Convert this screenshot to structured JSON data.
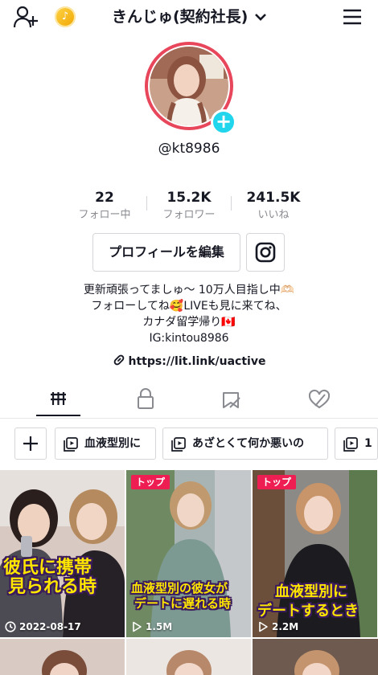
{
  "header": {
    "username": "きんじゅ(契約社長)"
  },
  "profile": {
    "handle": "@kt8986",
    "stats": [
      {
        "value": "22",
        "label": "フォロー中"
      },
      {
        "value": "15.2K",
        "label": "フォロワー"
      },
      {
        "value": "241.5K",
        "label": "いいね"
      }
    ],
    "edit_button": "プロフィールを編集",
    "bio": [
      "更新頑張ってましゅ〜 10万人目指し中🫶🏻",
      "フォローしてね🥰LIVEも見に来てね、",
      "カナダ留学帰り🇨🇦",
      "IG:kintou8986"
    ],
    "link": "https://lit.link/uactive"
  },
  "playlists": [
    "血液型別に",
    "あざとくて何か悪いの",
    "1"
  ],
  "videos": [
    {
      "caption_lines": [
        "彼氏に携帯",
        "見られる時"
      ],
      "meta": "2022-08-17",
      "meta_icon": "clock-icon",
      "badge": ""
    },
    {
      "caption_lines": [
        "血液型別の彼女が",
        "デートに遅れる時"
      ],
      "meta": "1.5M",
      "meta_icon": "play-icon",
      "badge": "トップ"
    },
    {
      "caption_lines": [
        "血液型別に",
        "デートするとき"
      ],
      "meta": "2.2M",
      "meta_icon": "play-icon",
      "badge": "トップ"
    }
  ],
  "colors": {
    "accent_pink": "#ee1d52",
    "add_blue": "#20d5ec",
    "avatar_ring": "#e8475b",
    "caption_yellow": "#ffe600"
  },
  "icons": [
    "add-user-icon",
    "coin-icon",
    "chevron-down-icon",
    "menu-icon",
    "instagram-icon",
    "link-icon",
    "videos-tab-icon",
    "lock-icon",
    "favorites-icon",
    "liked-icon",
    "plus-icon",
    "playlist-icon"
  ]
}
